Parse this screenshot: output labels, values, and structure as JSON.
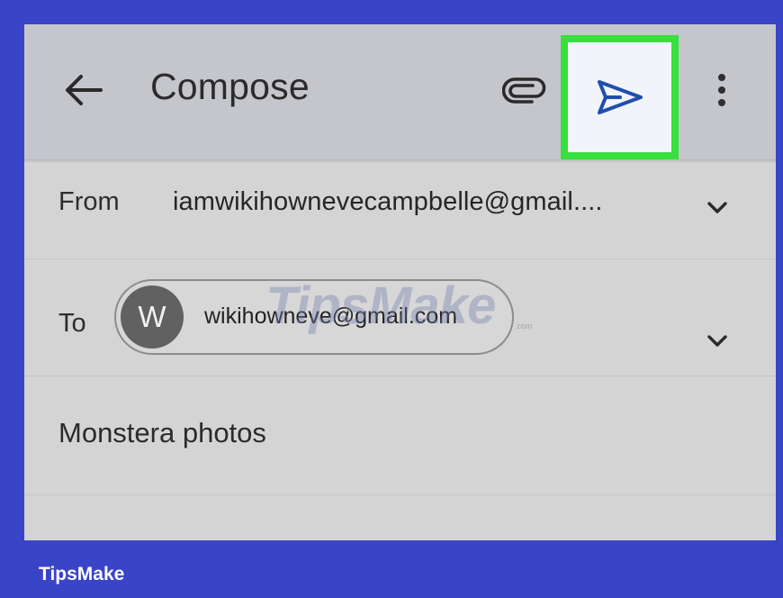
{
  "toolbar": {
    "title": "Compose",
    "back_icon": "arrow-left-icon",
    "attach_icon": "paperclip-icon",
    "send_icon": "send-icon",
    "more_icon": "more-vert-icon",
    "highlight_color": "#37e03c"
  },
  "from": {
    "label": "From",
    "value": "iamwikihownevecampbelle@gmail...."
  },
  "to": {
    "label": "To",
    "recipient_initial": "W",
    "recipient_email": "wikihowneve@gmail.com"
  },
  "subject": {
    "value": "Monstera photos"
  },
  "watermark": {
    "text": "TipsMake",
    "subtext": ".com"
  },
  "brand": {
    "text": "TipsMake",
    "background": "#3a44c6"
  }
}
